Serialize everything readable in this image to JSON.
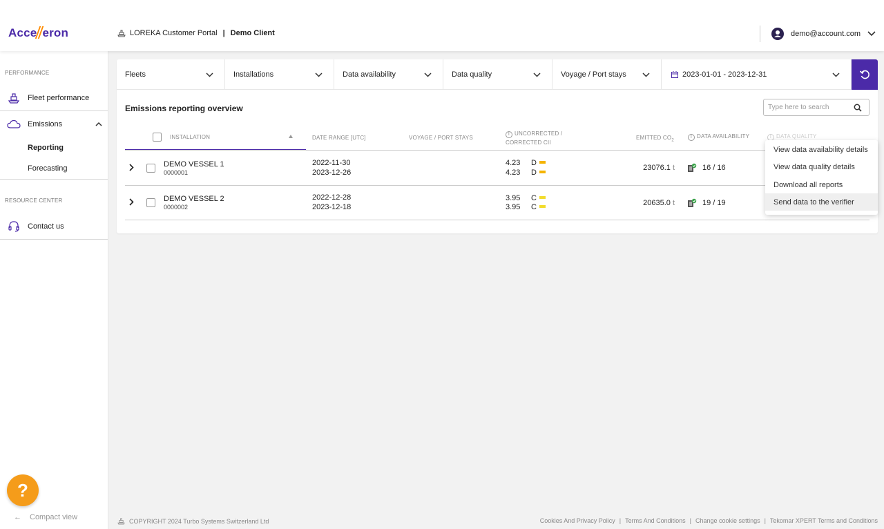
{
  "brand": {
    "logo_text_left": "Acce",
    "logo_text_right": "eron",
    "accent": "#4b2aa8",
    "logo_mark_color": "#ff8c00"
  },
  "header": {
    "portal_name": "LOREKA Customer Portal",
    "separator": "|",
    "client_name": "Demo Client",
    "user_email": "demo@account.com",
    "user_icon": "account-circle-icon"
  },
  "sidebar": {
    "performance_title": "PERFORMANCE",
    "fleet_performance": "Fleet performance",
    "emissions": "Emissions",
    "reporting": "Reporting",
    "forecasting": "Forecasting",
    "resource_title": "RESOURCE CENTER",
    "contact": "Contact us",
    "help_label": "?",
    "compact_view": "Compact view",
    "help_color": "#f59c1a"
  },
  "filters": {
    "fleets": "Fleets",
    "installations": "Installations",
    "data_availability": "Data availability",
    "data_quality": "Data quality",
    "voyage": "Voyage / Port stays",
    "date_range": "2023-01-01 - 2023-12-31"
  },
  "table": {
    "title": "Emissions reporting overview",
    "search_placeholder": "Type here to search",
    "headers": {
      "installation": "INSTALLATION",
      "date_range": "DATE RANGE [UTC]",
      "voyage": "VOYAGE / PORT STAYS",
      "cii_line1": "UNCORRECTED /",
      "cii_line2": "CORRECTED CII",
      "emitted": "EMITTED CO",
      "emitted_sub": "2",
      "availability": "DATA AVAILABILITY",
      "quality": "DATA QUALITY"
    },
    "rows": [
      {
        "name": "DEMO VESSEL 1",
        "id": "0000001",
        "date_from": "2022-11-30",
        "date_to": "2023-12-26",
        "cii_unc": "4.23",
        "cii_unc_grade": "D",
        "cii_cor": "4.23",
        "cii_cor_grade": "D",
        "cii_color": "#f5b400",
        "emitted": "23076.1",
        "unit": "t",
        "availability": "16 / 16"
      },
      {
        "name": "DEMO VESSEL 2",
        "id": "0000002",
        "date_from": "2022-12-28",
        "date_to": "2023-12-18",
        "cii_unc": "3.95",
        "cii_unc_grade": "C",
        "cii_cor": "3.95",
        "cii_cor_grade": "C",
        "cii_color": "#f2dc2c",
        "emitted": "20635.0",
        "unit": "t",
        "availability": "19 / 19"
      }
    ]
  },
  "menu": {
    "item1": "View data availability details",
    "item2": "View data quality details",
    "item3": "Download all reports",
    "item4": "Send data to the verifier"
  },
  "footer": {
    "copyright": "COPYRIGHT 2024 Turbo Systems Switzerland Ltd",
    "cookies": "Cookies And Privacy Policy",
    "sep": "|",
    "terms": "Terms And Conditions",
    "cookie_settings": "Change cookie settings",
    "xpert_terms": "Tekomar XPERT Terms and Conditions"
  }
}
